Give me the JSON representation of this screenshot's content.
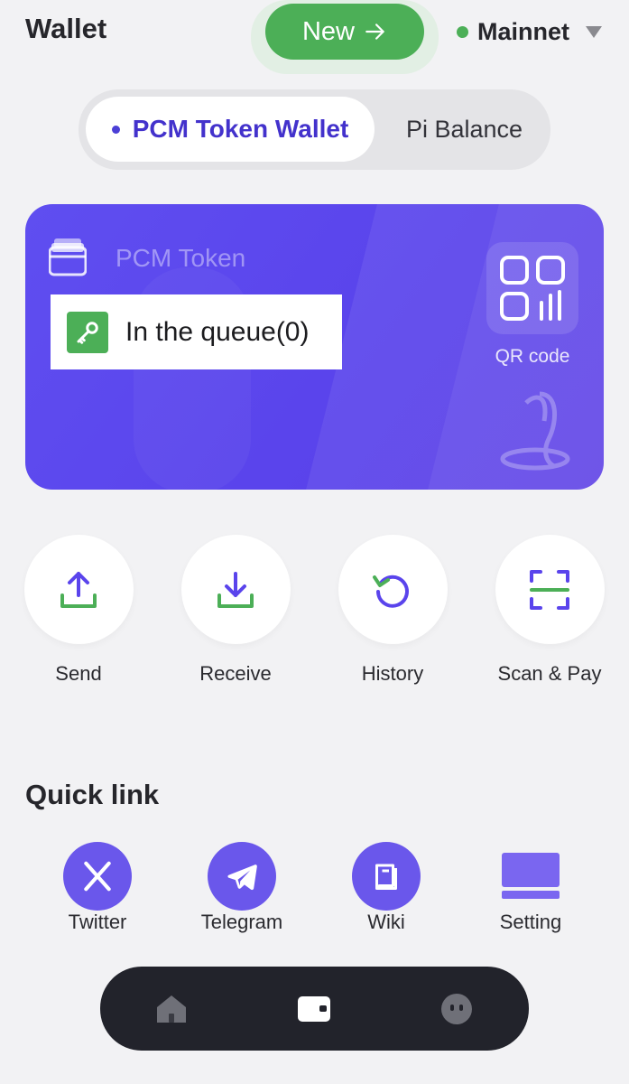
{
  "header": {
    "title": "Wallet",
    "new_button_label": "New",
    "network_label": "Mainnet",
    "network_status_color": "#4caf57"
  },
  "wallet_tabs": {
    "active_label": "PCM Token Wallet",
    "inactive_label": "Pi Balance"
  },
  "card": {
    "token_name": "PCM Token",
    "queue_text": "In the queue(0)",
    "qr_label": "QR code",
    "accent_color": "#5a44ec"
  },
  "actions": [
    {
      "label": "Send",
      "icon": "upload-icon"
    },
    {
      "label": "Receive",
      "icon": "download-icon"
    },
    {
      "label": "History",
      "icon": "history-icon"
    },
    {
      "label": "Scan & Pay",
      "icon": "scan-icon"
    }
  ],
  "quick_link": {
    "title": "Quick link",
    "items": [
      {
        "label": "Twitter",
        "icon": "x-logo-icon"
      },
      {
        "label": "Telegram",
        "icon": "telegram-icon"
      },
      {
        "label": "Wiki",
        "icon": "book-icon"
      },
      {
        "label": "Setting",
        "icon": "setting-icon"
      }
    ]
  },
  "bottom_nav": {
    "items": [
      {
        "icon": "home-icon"
      },
      {
        "icon": "wallet-icon"
      },
      {
        "icon": "profile-icon"
      }
    ]
  }
}
